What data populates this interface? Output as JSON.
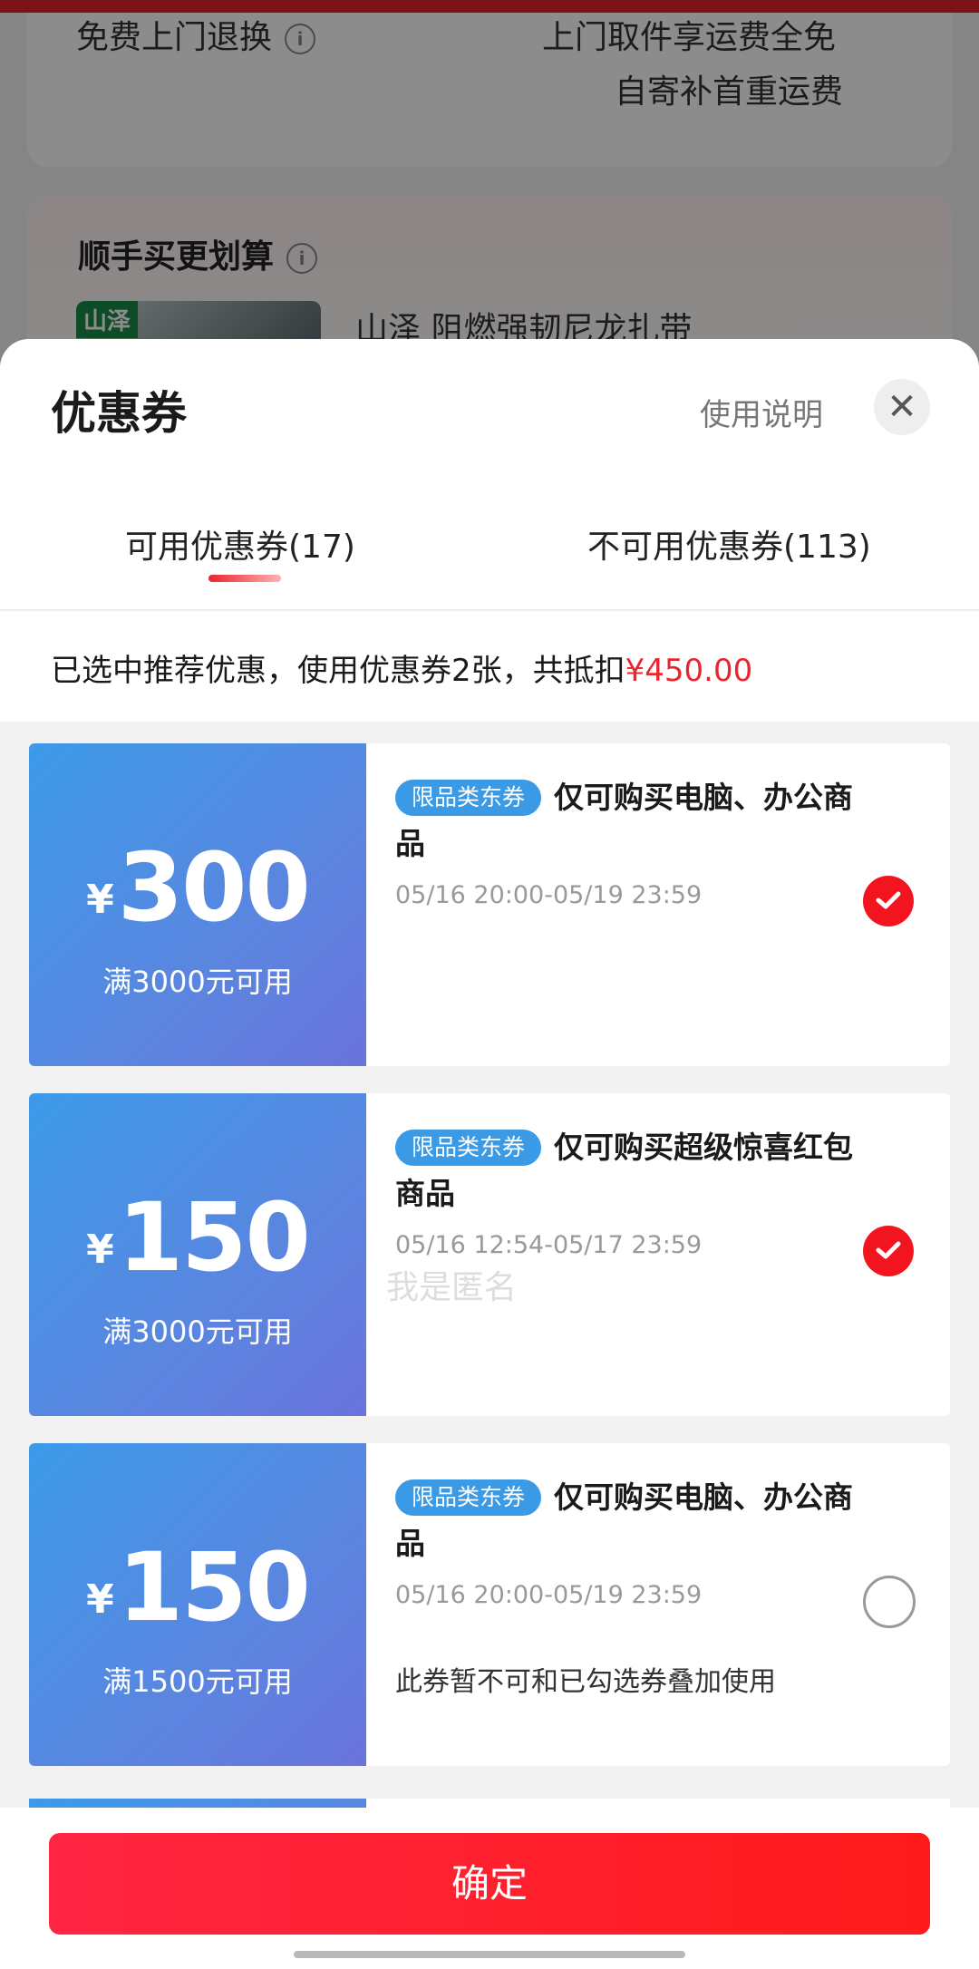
{
  "background": {
    "row1_left": "免费上门退换",
    "row1_right": "上门取件享运费全免",
    "row1_right_sub": "自寄补首重运费",
    "section_title": "顺手买更划算",
    "product_thumb_label": "山泽",
    "product_name": "山泽 阻燃强韧尼龙扎带"
  },
  "sheet": {
    "title": "优惠券",
    "usage_link": "使用说明",
    "close_icon": "close-icon"
  },
  "tabs": [
    {
      "label": "可用优惠券(17)",
      "active": true
    },
    {
      "label": "不可用优惠券(113)",
      "active": false
    }
  ],
  "summary": {
    "text": "已选中推荐优惠，使用优惠券2张，共抵扣",
    "amount": "¥450.00"
  },
  "coupons": [
    {
      "currency": "¥",
      "amount": "300",
      "threshold": "满3000元可用",
      "tag": "限品类东券",
      "title": "仅可购买电脑、办公商品",
      "date": "05/16 20:00-05/19 23:59",
      "note": "",
      "selected": true
    },
    {
      "currency": "¥",
      "amount": "150",
      "threshold": "满3000元可用",
      "tag": "限品类东券",
      "title": "仅可购买超级惊喜红包商品",
      "date": "05/16 12:54-05/17 23:59",
      "note": "",
      "selected": true
    },
    {
      "currency": "¥",
      "amount": "150",
      "threshold": "满1500元可用",
      "tag": "限品类东券",
      "title": "仅可购买电脑、办公商品",
      "date": "05/16 20:00-05/19 23:59",
      "note": "此券暂不可和已勾选券叠加使用",
      "selected": false
    }
  ],
  "watermark": "我是匿名",
  "confirm_label": "确定",
  "colors": {
    "accent_red": "#e8262d",
    "coupon_blue": "#3c9ae8",
    "tag_blue": "#3a9ae6"
  }
}
